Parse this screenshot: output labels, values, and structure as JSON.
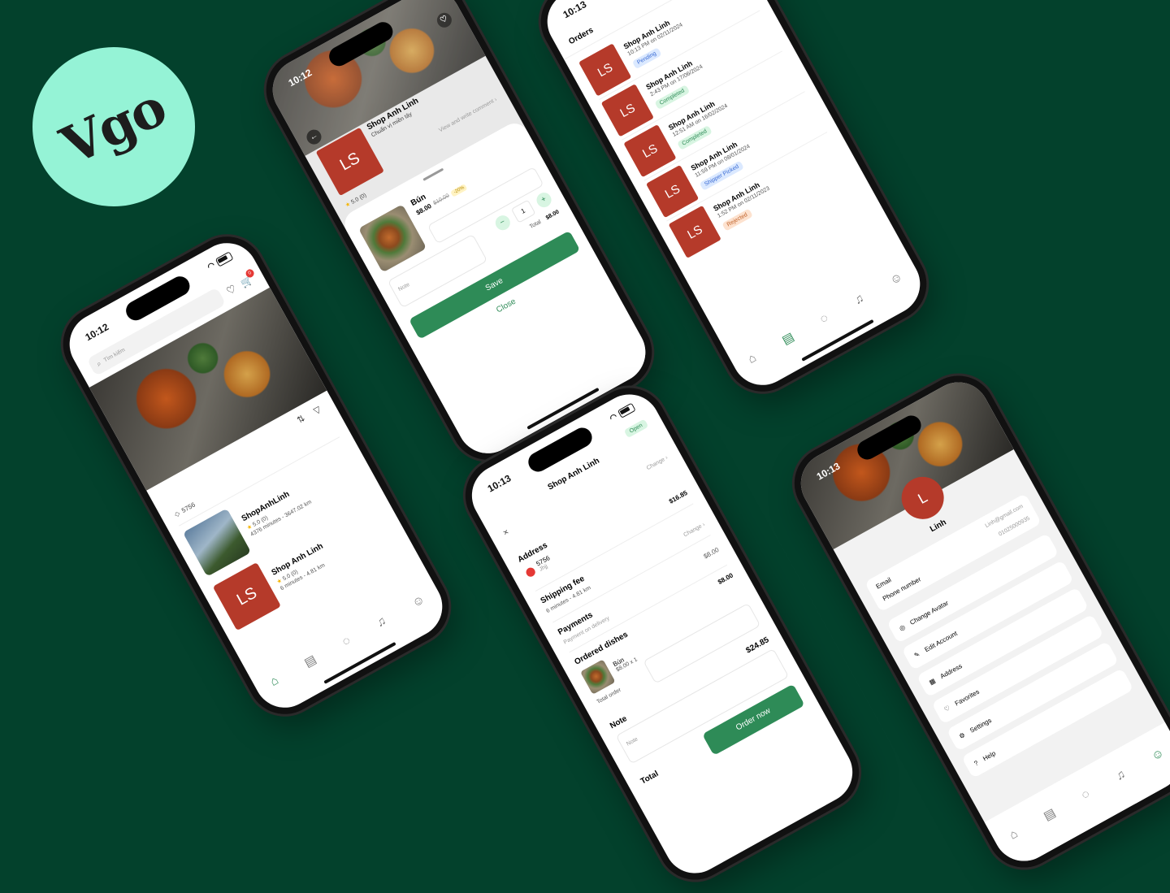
{
  "brand": {
    "logo_text": "Vgo"
  },
  "phone1": {
    "time": "10:12",
    "search_placeholder": "Tìm kiếm",
    "cart_count": "0",
    "location": "5756",
    "shops": [
      {
        "name": "ShopAnhLinh",
        "rating": "5.0 (0)",
        "meta": "4376 minutes - 3647.02 km"
      },
      {
        "name": "Shop Anh Linh",
        "rating": "5.0 (0)",
        "meta": "6 minutes - 4.81 km",
        "initials": "LS"
      }
    ]
  },
  "phone2": {
    "time": "10:12",
    "shop_name": "Shop Anh Linh",
    "shop_sub": "Chuẩn vị miền tây",
    "initials": "LS",
    "comment_link": "View and write comment",
    "rating": "5.0 (0)",
    "dish": {
      "name": "Bún",
      "price": "$8.00",
      "old_price": "$10.00",
      "discount": "-20%"
    },
    "note_placeholder": "Note",
    "qty": "1",
    "total_label": "Total",
    "total_value": "$8.00",
    "save_label": "Save",
    "close_label": "Close"
  },
  "phone3": {
    "time": "10:13",
    "title": "Orders",
    "orders": [
      {
        "shop": "Shop Anh Linh",
        "time": "10:13 PM on 02/11/2024",
        "status": "Pending",
        "cls": "b-pending"
      },
      {
        "shop": "Shop Anh Linh",
        "time": "2:43 PM on 17/06/2024",
        "status": "Completed",
        "cls": "b-completed"
      },
      {
        "shop": "Shop Anh Linh",
        "time": "12:51 AM on 16/02/2024",
        "status": "Completed",
        "cls": "b-completed"
      },
      {
        "shop": "Shop Anh Linh",
        "time": "11:59 PM on 08/01/2024",
        "status": "Shipper Picked",
        "cls": "b-picked"
      },
      {
        "shop": "Shop Anh Linh",
        "time": "1:52 PM on 02/11/2023",
        "status": "Rejected",
        "cls": "b-rejected"
      }
    ],
    "initials": "LS"
  },
  "phone4": {
    "time": "10:13",
    "title": "Shop Anh Linh",
    "open_badge": "Open",
    "change_label": "Change",
    "address_label": "Address",
    "address_line": "5756",
    "address_sub": "Jhjj",
    "shipping_label": "Shipping fee",
    "shipping_meta": "6 minutes - 4.81 km",
    "shipping_value": "$16.85",
    "payments_label": "Payments",
    "payment_method": "Payment on delivery",
    "ordered_label": "Ordered dishes",
    "ordered_value": "$8.00",
    "ordered_sum": "$8.00",
    "dish_name": "Bún",
    "dish_qty": "$8.00 x 1",
    "total_order_label": "Total order",
    "note_label": "Note",
    "note_placeholder": "Note",
    "grand_total": "$24.85",
    "total_label": "Total",
    "order_button": "Order now"
  },
  "phone5": {
    "time": "10:13",
    "avatar_initial": "L",
    "name": "Linh",
    "email_label": "Email",
    "email_value": "Linh@gmail.com",
    "phone_label": "Phone number",
    "phone_value": "01025000935",
    "menu": [
      "Change Avatar",
      "Edit Account",
      "Address",
      "Favorites",
      "Settings",
      "Help"
    ]
  }
}
